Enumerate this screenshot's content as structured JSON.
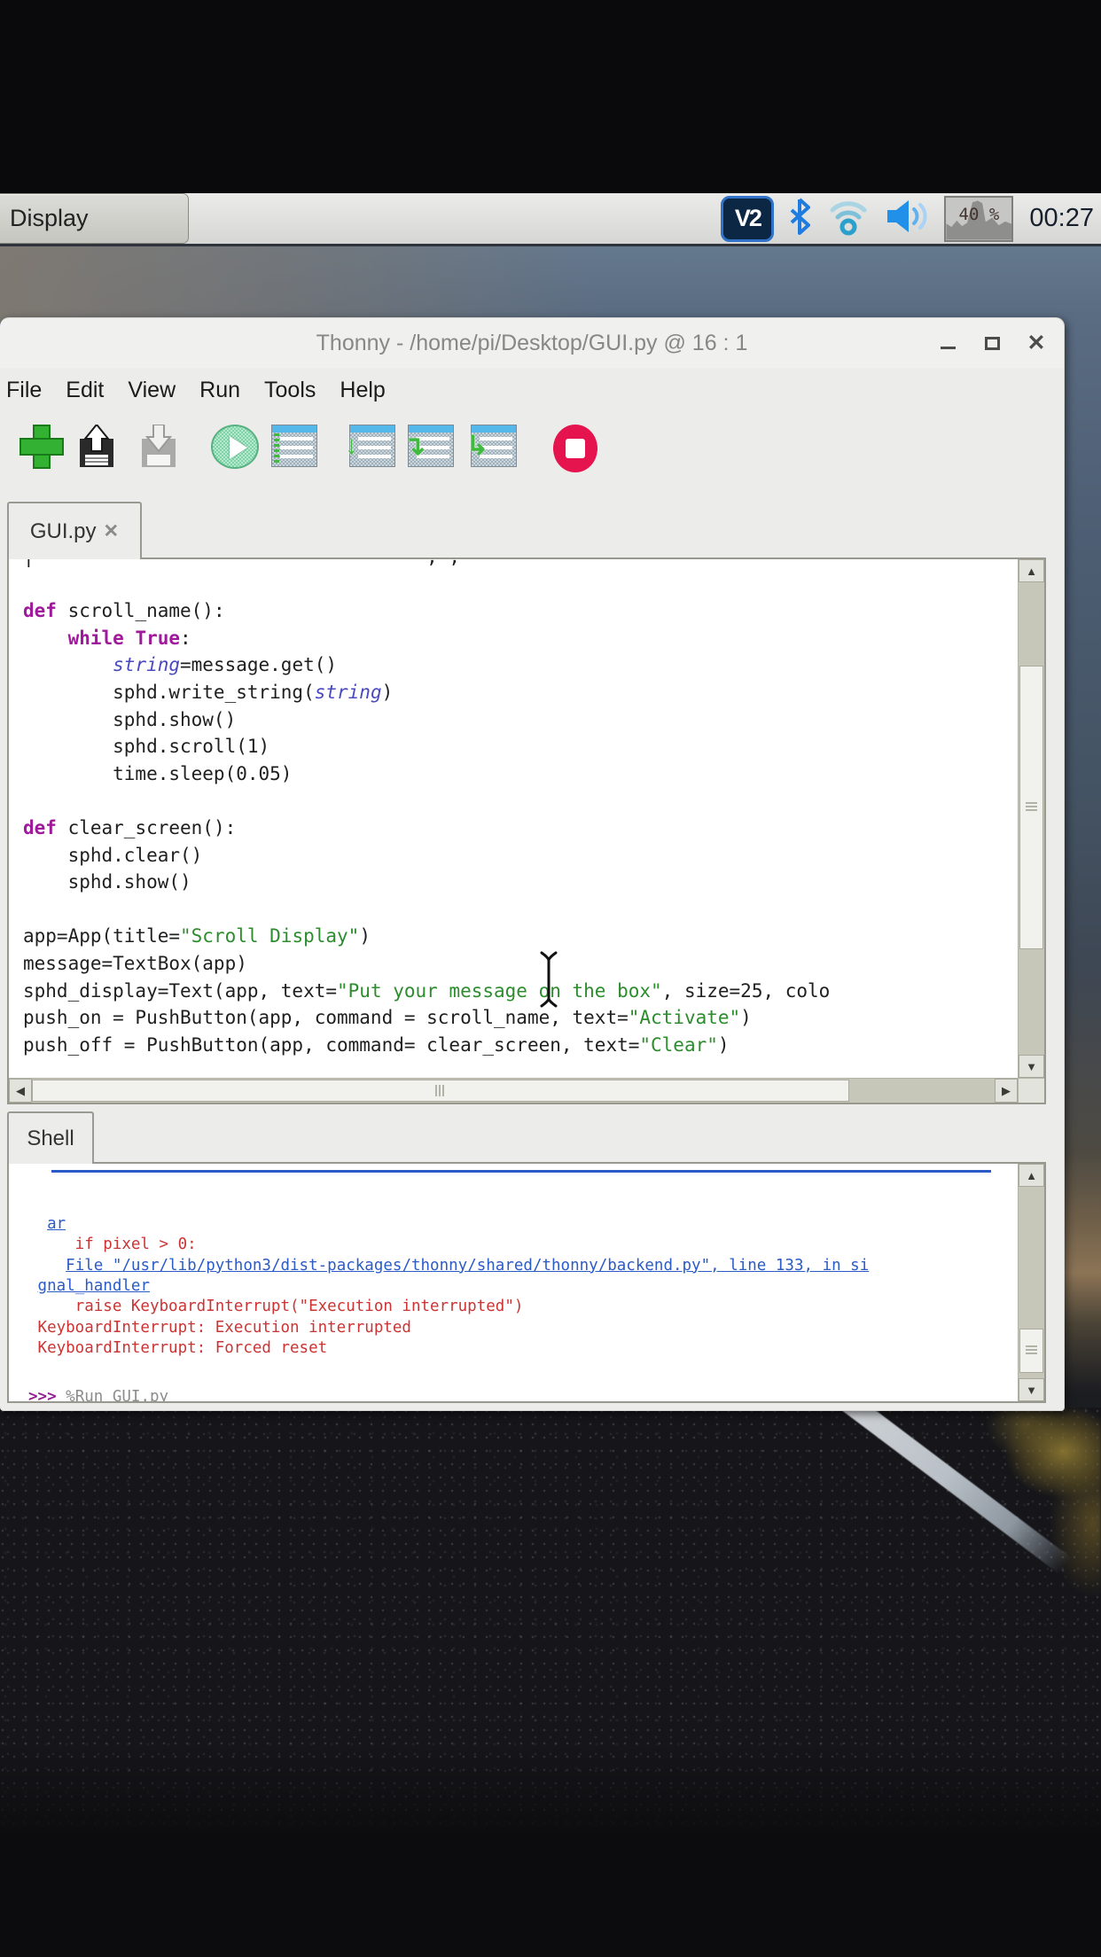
{
  "taskbar": {
    "app_button_label": "Display",
    "vnc_label": "V2",
    "cpu_text": "40 %",
    "clock": "00:27"
  },
  "window": {
    "title": "Thonny  -  /home/pi/Desktop/GUI.py  @  16 : 1",
    "close_glyph": "✕"
  },
  "menu": {
    "items": [
      "File",
      "Edit",
      "View",
      "Run",
      "Tools",
      "Help"
    ]
  },
  "toolbar": {
    "buttons": [
      "new-file",
      "open-file",
      "save-file",
      "run-current-script",
      "debug-current-script",
      "step-over",
      "step-into",
      "step-out",
      "stop"
    ],
    "step_over_glyph": "↓",
    "step_into_glyph": "↴",
    "step_out_glyph": "↳"
  },
  "tabs": {
    "editor": "GUI.py",
    "editor_close": "✕",
    "shell": "Shell"
  },
  "icons": {
    "up": "▲",
    "down": "▼",
    "left": "◀",
    "right": "▶"
  },
  "colors": {
    "keyword": "#a0189b",
    "string": "#2d8c2d",
    "variable_italic": "#4949c0",
    "error_red": "#cc3434",
    "link_blue": "#2a5bc7",
    "prompt_magenta": "#922092",
    "magic_gray": "#8c8c8c",
    "accent_blue_header": "#54b8ea",
    "stop_red": "#e5134e",
    "run_green": "#33b133"
  },
  "editor": {
    "lines": [
      [
        {
          "t": "|                                   , ,",
          "c": "d"
        }
      ],
      [],
      [
        {
          "t": "def",
          "c": "k"
        },
        {
          "t": " scroll_name():",
          "c": "d"
        }
      ],
      [
        {
          "t": "    ",
          "c": "d"
        },
        {
          "t": "while",
          "c": "k"
        },
        {
          "t": " ",
          "c": "d"
        },
        {
          "t": "True",
          "c": "k"
        },
        {
          "t": ":",
          "c": "d"
        }
      ],
      [
        {
          "t": "        ",
          "c": "d"
        },
        {
          "t": "string",
          "c": "v"
        },
        {
          "t": "=message.get()",
          "c": "d"
        }
      ],
      [
        {
          "t": "        sphd.write_string(",
          "c": "d"
        },
        {
          "t": "string",
          "c": "v"
        },
        {
          "t": ")",
          "c": "d"
        }
      ],
      [
        {
          "t": "        sphd.show()",
          "c": "d"
        }
      ],
      [
        {
          "t": "        sphd.scroll(1)",
          "c": "d"
        }
      ],
      [
        {
          "t": "        time.sleep(0.05)",
          "c": "d"
        }
      ],
      [],
      [
        {
          "t": "def",
          "c": "k"
        },
        {
          "t": " clear_screen():",
          "c": "d"
        }
      ],
      [
        {
          "t": "    sphd.clear()",
          "c": "d"
        }
      ],
      [
        {
          "t": "    sphd.show()",
          "c": "d"
        }
      ],
      [],
      [
        {
          "t": "app=App(title=",
          "c": "d"
        },
        {
          "t": "\"Scroll Display\"",
          "c": "s"
        },
        {
          "t": ")",
          "c": "d"
        }
      ],
      [
        {
          "t": "message=TextBox(app)",
          "c": "d"
        }
      ],
      [
        {
          "t": "sphd_display=Text(app, text=",
          "c": "d"
        },
        {
          "t": "\"Put your message on the box\"",
          "c": "s"
        },
        {
          "t": ", size=25, colo",
          "c": "d"
        }
      ],
      [
        {
          "t": "push_on = PushButton(app, command = scroll_name, text=",
          "c": "d"
        },
        {
          "t": "\"Activate\"",
          "c": "s"
        },
        {
          "t": ")",
          "c": "d"
        }
      ],
      [
        {
          "t": "push_off = PushButton(app, command= clear_screen, text=",
          "c": "d"
        },
        {
          "t": "\"Clear\"",
          "c": "s"
        },
        {
          "t": ")",
          "c": "d"
        }
      ]
    ]
  },
  "shell": {
    "lines": [
      [
        {
          "t": "  ",
          "c": "err"
        },
        {
          "t": "ar",
          "c": "lnk"
        }
      ],
      [
        {
          "t": "     if pixel > 0:",
          "c": "err"
        }
      ],
      [
        {
          "t": "    ",
          "c": "err"
        },
        {
          "t": "File \"/usr/lib/python3/dist-packages/thonny/shared/thonny/backend.py\", line 133, in si",
          "c": "lnk"
        }
      ],
      [
        {
          "t": " ",
          "c": "err"
        },
        {
          "t": "gnal_handler",
          "c": "lnk"
        }
      ],
      [
        {
          "t": "     raise KeyboardInterrupt(\"Execution interrupted\")",
          "c": "err"
        }
      ],
      [
        {
          "t": " KeyboardInterrupt: Execution interrupted",
          "c": "err"
        }
      ],
      [
        {
          "t": " KeyboardInterrupt: Forced reset",
          "c": "err"
        }
      ],
      [],
      [
        {
          "t": ">>> ",
          "c": "pr"
        },
        {
          "t": "%Run GUI.py",
          "c": "mg"
        }
      ]
    ]
  }
}
